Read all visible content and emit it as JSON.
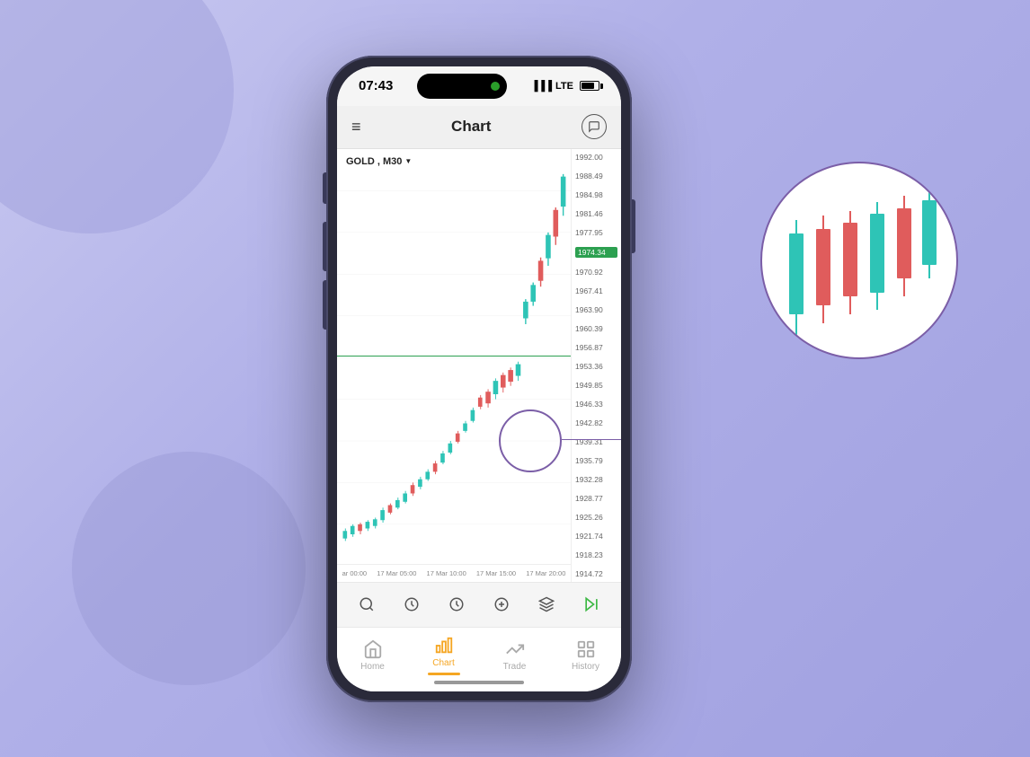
{
  "background": {
    "color": "#c0c0e8"
  },
  "phone": {
    "status_bar": {
      "time": "07:43",
      "carrier": "LTE"
    },
    "header": {
      "title": "Chart",
      "menu_label": "≡",
      "chat_label": "💬"
    },
    "chart": {
      "instrument": "GOLD",
      "timeframe": "M30",
      "price_levels": [
        "1992.00",
        "1988.49",
        "1984.98",
        "1981.46",
        "1977.95",
        "1974.34",
        "1970.92",
        "1967.41",
        "1963.90",
        "1960.39",
        "1956.87",
        "1953.36",
        "1949.85",
        "1946.33",
        "1942.82",
        "1939.31",
        "1935.79",
        "1932.28",
        "1928.77",
        "1925.26",
        "1921.74",
        "1918.23",
        "1914.72"
      ],
      "active_price": "1974.34",
      "time_labels": [
        "ar 00:00",
        "17 Mar 05:00",
        "17 Mar 10:00",
        "17 Mar 15:00",
        "17 Mar 20:00"
      ]
    },
    "toolbar": {
      "icons": [
        "cursor",
        "clock-circle",
        "clock",
        "plus",
        "layers",
        "play-forward"
      ]
    },
    "bottom_nav": {
      "items": [
        {
          "label": "Home",
          "icon": "⌂",
          "active": false
        },
        {
          "label": "Chart",
          "icon": "📊",
          "active": true
        },
        {
          "label": "Trade",
          "icon": "📈",
          "active": false
        },
        {
          "label": "History",
          "icon": "⊞",
          "active": false
        }
      ]
    }
  }
}
